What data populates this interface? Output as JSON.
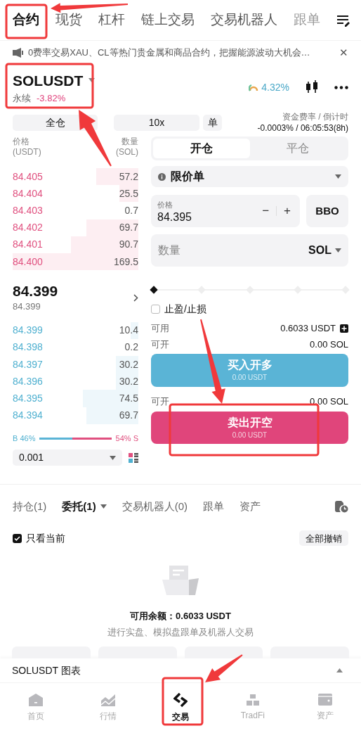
{
  "top_tabs": [
    {
      "label": "合约",
      "selected": true
    },
    {
      "label": "现货",
      "selected": false
    },
    {
      "label": "杠杆",
      "selected": false
    },
    {
      "label": "链上交易",
      "selected": false
    },
    {
      "label": "交易机器人",
      "selected": false
    },
    {
      "label": "跟单",
      "selected": false
    }
  ],
  "banner": {
    "text": "0费率交易XAU、CL等热门贵金属和商品合约，把握能源波动大机会…",
    "close": "✕"
  },
  "instrument": {
    "symbol": "SOLUSDT",
    "type": "永续",
    "change": "-3.82%",
    "sentiment": "4.32%"
  },
  "margin": {
    "mode": "全仓",
    "leverage": "10x",
    "position_mode": "单",
    "funding_label": "资金费率 / 倒计时",
    "funding_value": "-0.0003% / 06:05:53(8h)"
  },
  "order_book": {
    "price_header": [
      "价格",
      "(USDT)"
    ],
    "qty_header": [
      "数量",
      "(SOL)"
    ],
    "asks": [
      {
        "price": "84.405",
        "qty": "57.2"
      },
      {
        "price": "84.404",
        "qty": "25.5"
      },
      {
        "price": "84.403",
        "qty": "0.7"
      },
      {
        "price": "84.402",
        "qty": "69.7"
      },
      {
        "price": "84.401",
        "qty": "90.7"
      },
      {
        "price": "84.400",
        "qty": "169.5"
      }
    ],
    "last_price": "84.399",
    "mark_price": "84.399",
    "bids": [
      {
        "price": "84.399",
        "qty": "10.4"
      },
      {
        "price": "84.398",
        "qty": "0.2"
      },
      {
        "price": "84.397",
        "qty": "30.2"
      },
      {
        "price": "84.396",
        "qty": "30.2"
      },
      {
        "price": "84.395",
        "qty": "74.5"
      },
      {
        "price": "84.394",
        "qty": "69.7"
      }
    ],
    "buy_ratio": {
      "buy": "B 46%",
      "sell": "54% S",
      "level": 0.46
    },
    "precision": "0.001"
  },
  "order_form": {
    "sides": [
      {
        "label": "开仓",
        "selected": true
      },
      {
        "label": "平仓",
        "selected": false
      }
    ],
    "order_type": "限价单",
    "price": {
      "label": "价格",
      "value": "84.395",
      "minus": "−",
      "plus": "+"
    },
    "bbo": "BBO",
    "quantity": {
      "placeholder": "数量",
      "unit": "SOL"
    },
    "slider": {
      "level": 0
    },
    "tpsl": {
      "label": "止盈/止损",
      "checked": false
    },
    "available_label": "可用",
    "available_value": "0.6033 USDT",
    "buy_max_label": "可开",
    "buy_max_value": "0.00 SOL",
    "buy_button": {
      "label": "买入开多",
      "sub": "0.00 USDT"
    },
    "sell_max_label": "可开",
    "sell_max_value": "0.00 SOL",
    "sell_button": {
      "label": "卖出开空",
      "sub": "0.00 USDT"
    }
  },
  "orders": {
    "tabs": [
      {
        "label": "持仓(1)",
        "selected": false
      },
      {
        "label": "委托(1)",
        "selected": true
      },
      {
        "label": "交易机器人(0)",
        "selected": false
      },
      {
        "label": "跟单",
        "selected": false
      },
      {
        "label": "资产",
        "selected": false
      }
    ],
    "only_current": {
      "label": "只看当前",
      "checked": true
    },
    "cancel_all": "全部撤销",
    "empty_title": "可用余额：0.6033 USDT",
    "empty_text": "进行实盘、模拟盘跟单及机器人交易"
  },
  "chart_bar": {
    "label": "SOLUSDT 图表"
  },
  "nav": [
    {
      "label": "首页",
      "selected": false
    },
    {
      "label": "行情",
      "selected": false
    },
    {
      "label": "交易",
      "selected": true
    },
    {
      "label": "TradFi",
      "selected": false
    },
    {
      "label": "资产",
      "selected": false
    }
  ]
}
